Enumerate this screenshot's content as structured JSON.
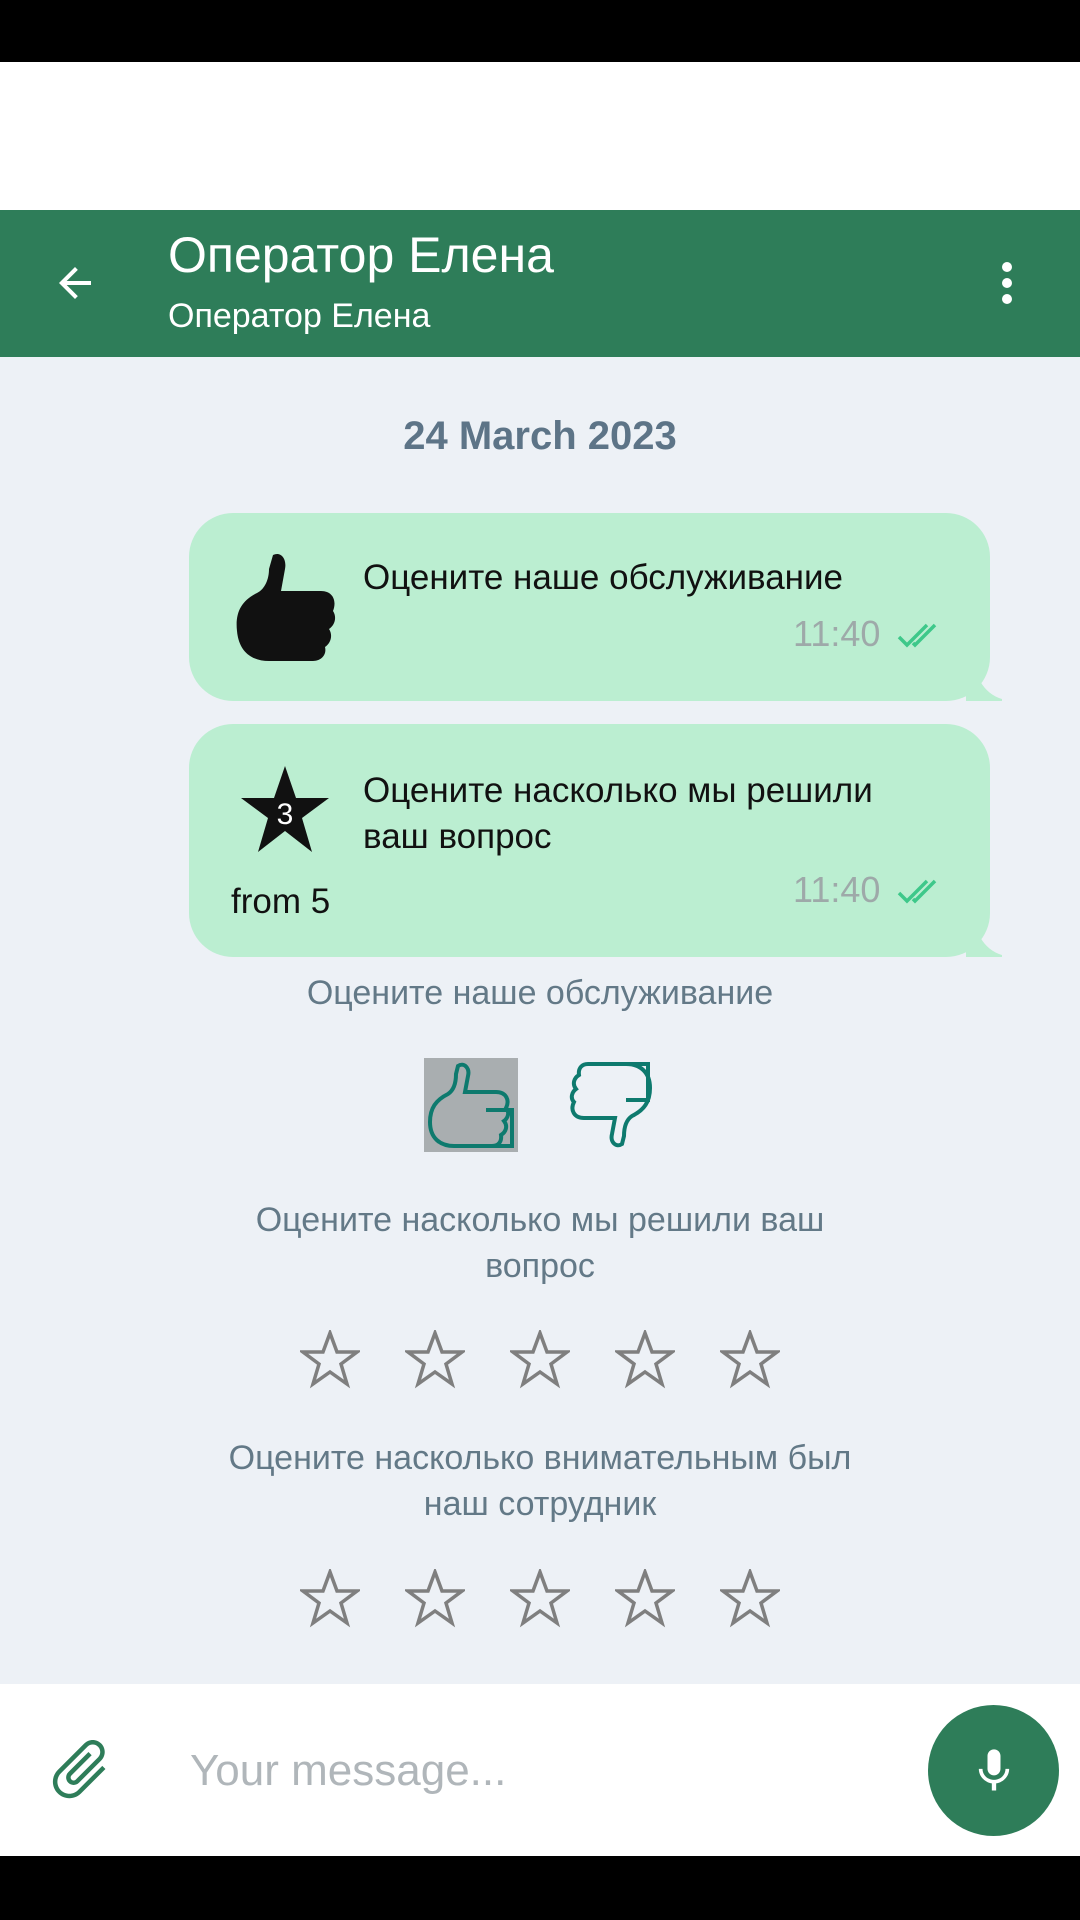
{
  "header": {
    "title": "Оператор Елена",
    "subtitle": "Оператор Елена",
    "back_icon": "arrow-left-icon",
    "menu_icon": "more-vertical-icon"
  },
  "chat": {
    "date": "24 March 2023",
    "messages": [
      {
        "icon": "thumbs-up-icon",
        "text": "Оцените наше обслуживание",
        "time": "11:40",
        "status_icon": "double-check-icon"
      },
      {
        "icon": "star-icon",
        "rating": "3",
        "text": "Оцените насколько мы решили ваш вопрос",
        "scale": "from 5",
        "time": "11:40",
        "status_icon": "double-check-icon"
      }
    ]
  },
  "survey": {
    "service": {
      "prompt": "Оцените наше обслуживание",
      "selected": "thumbs-up"
    },
    "resolution": {
      "prompt": "Оцените насколько мы решили ваш вопрос",
      "stars": 5
    },
    "attentiveness": {
      "prompt": "Оцените насколько внимательным был наш сотрудник",
      "stars": 5
    }
  },
  "composer": {
    "placeholder": "Your message...",
    "attach_icon": "paperclip-icon",
    "mic_icon": "microphone-icon"
  },
  "colors": {
    "accent": "#2e7d59",
    "bubble": "#bbeed1",
    "background": "#edf1f6",
    "check": "#3ec88a"
  }
}
